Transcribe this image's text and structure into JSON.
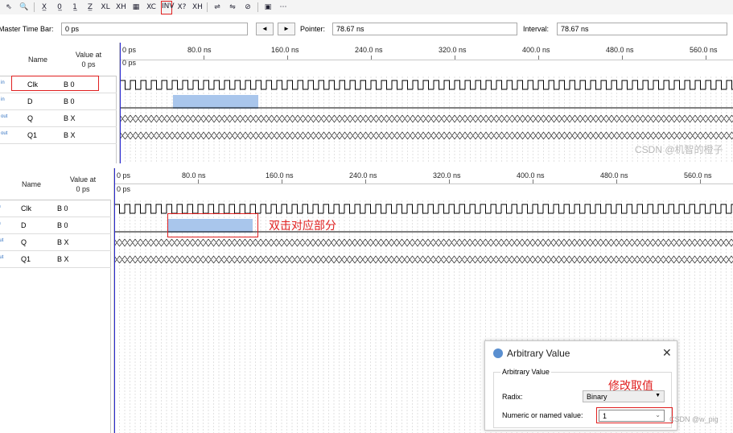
{
  "toolbar": {
    "buttons": [
      "⇖",
      "🔍",
      "X̲",
      "0̲",
      "1̲",
      "Z̲",
      "XL",
      "XH",
      "▦",
      "XC",
      "INV",
      "X?",
      "XH"
    ],
    "extra": [
      "⇌",
      "⇋",
      "⊘",
      "▣",
      "⋯"
    ]
  },
  "timebar": {
    "master_label": "Master Time Bar:",
    "master_value": "0 ps",
    "prev": "◄",
    "next": "►",
    "pointer_label": "Pointer:",
    "pointer_value": "78.67 ns",
    "interval_label": "Interval:",
    "interval_value": "78.67 ns"
  },
  "top": {
    "col_name": "Name",
    "col_value_l1": "Value at",
    "col_value_l2": "0 ps",
    "ruler": [
      "0 ps",
      "80.0 ns",
      "160.0 ns",
      "240.0 ns",
      "320.0 ns",
      "400.0 ns",
      "480.0 ns",
      "560.0 ns"
    ],
    "cursor_label": "0 ps",
    "signals": [
      {
        "icon": "in",
        "name": "Clk",
        "value": "B 0"
      },
      {
        "icon": "in",
        "name": "D",
        "value": "B 0"
      },
      {
        "icon": "out",
        "name": "Q",
        "value": "B X"
      },
      {
        "icon": "out",
        "name": "Q1",
        "value": "B X"
      }
    ],
    "watermark": "CSDN @机智的橙子"
  },
  "bottom": {
    "col_name": "Name",
    "col_value_l1": "Value at",
    "col_value_l2": "0 ps",
    "ruler": [
      "0 ps",
      "80.0 ns",
      "160.0 ns",
      "240.0 ns",
      "320.0 ns",
      "400.0 ns",
      "480.0 ns",
      "560.0 ns"
    ],
    "cursor_label": "0 ps",
    "signals": [
      {
        "icon": "in",
        "name": "Clk",
        "value": "B 0"
      },
      {
        "icon": "in",
        "name": "D",
        "value": "B 0"
      },
      {
        "icon": "out",
        "name": "Q",
        "value": "B X"
      },
      {
        "icon": "out",
        "name": "Q1",
        "value": "B X"
      }
    ],
    "annotation": "双击对应部分"
  },
  "dialog": {
    "title": "Arbitrary Value",
    "group": "Arbitrary Value",
    "radix_label": "Radix:",
    "radix_value": "Binary",
    "numeric_label": "Numeric or named value:",
    "numeric_value": "1",
    "annotation": "修改取值",
    "close": "✕"
  },
  "watermark2": "CSDN @w_pig"
}
